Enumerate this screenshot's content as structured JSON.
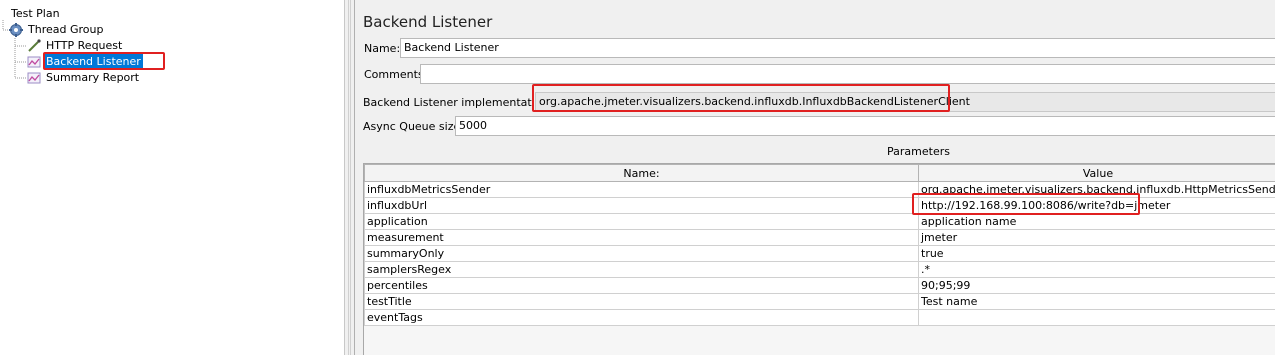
{
  "tree": {
    "items": [
      {
        "label": "Test Plan",
        "icon": "test-plan-icon"
      },
      {
        "label": "Thread Group",
        "icon": "gear-icon"
      },
      {
        "label": "HTTP Request",
        "icon": "pipette-icon"
      },
      {
        "label": "Backend Listener",
        "icon": "graph-listener-icon"
      },
      {
        "label": "Summary Report",
        "icon": "graph-listener-icon"
      }
    ]
  },
  "panel": {
    "title": "Backend Listener",
    "name_label": "Name:",
    "name_value": "Backend Listener",
    "comments_label": "Comments:",
    "comments_value": "",
    "impl_label": "Backend Listener implementation",
    "impl_value": "org.apache.jmeter.visualizers.backend.influxdb.InfluxdbBackendListenerClient",
    "queue_label": "Async Queue size",
    "queue_value": "5000"
  },
  "parameters": {
    "title": "Parameters",
    "columns": [
      "Name:",
      "Value"
    ],
    "rows": [
      {
        "name": "influxdbMetricsSender",
        "value": "org.apache.jmeter.visualizers.backend.influxdb.HttpMetricsSender"
      },
      {
        "name": "influxdbUrl",
        "value": "http://192.168.99.100:8086/write?db=jmeter"
      },
      {
        "name": "application",
        "value": "application name"
      },
      {
        "name": "measurement",
        "value": "jmeter"
      },
      {
        "name": "summaryOnly",
        "value": "true"
      },
      {
        "name": "samplersRegex",
        "value": ".*"
      },
      {
        "name": "percentiles",
        "value": "90;95;99"
      },
      {
        "name": "testTitle",
        "value": "Test name"
      },
      {
        "name": "eventTags",
        "value": ""
      }
    ]
  },
  "colors": {
    "highlight": "#e02020",
    "selection": "#0078d7"
  }
}
